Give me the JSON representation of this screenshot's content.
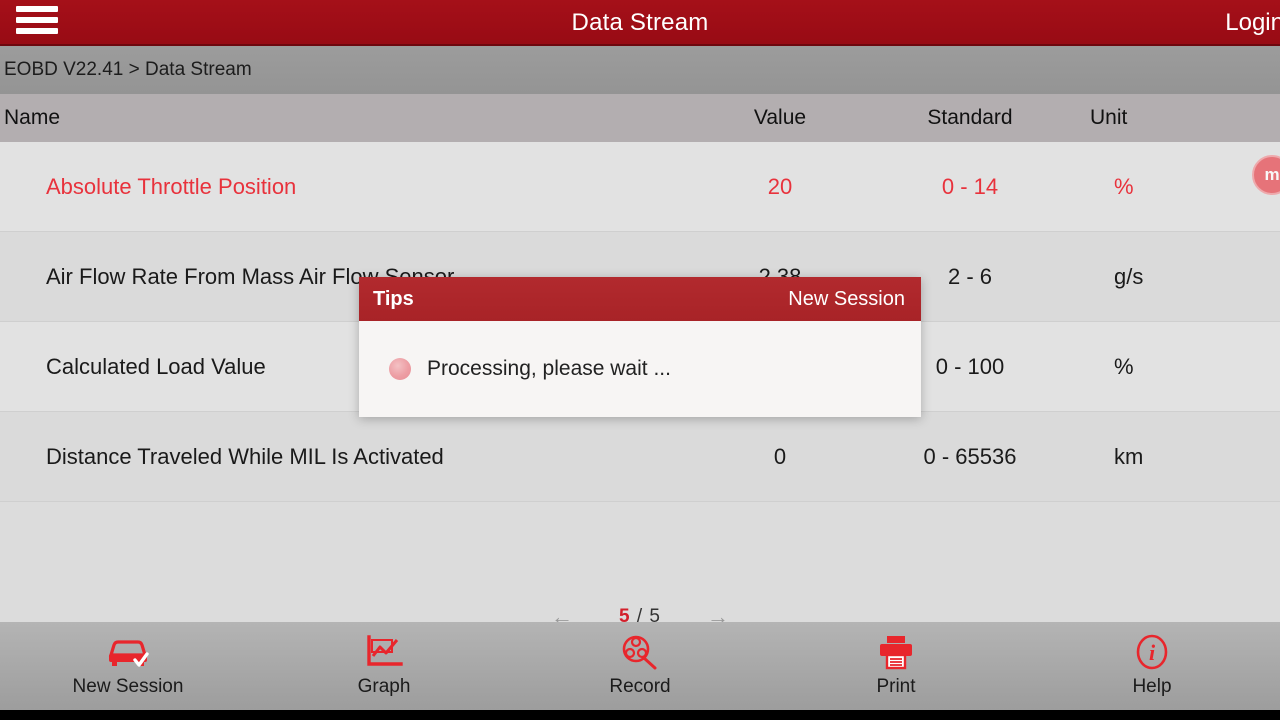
{
  "titlebar": {
    "menu_icon": "hamburger-menu-icon",
    "title": "Data Stream",
    "login_label": "Login",
    "background_color": "#9d0d17"
  },
  "breadcrumb": {
    "text": "EOBD V22.41 > Data Stream"
  },
  "table": {
    "headers": {
      "name": "Name",
      "value": "Value",
      "standard": "Standard",
      "unit": "Unit"
    },
    "rows": [
      {
        "name": "Absolute Throttle Position",
        "value": "20",
        "standard": "0 - 14",
        "unit": "%",
        "alert": true
      },
      {
        "name": "Air Flow Rate From Mass Air Flow Sensor",
        "value": "2.38",
        "standard": "2 - 6",
        "unit": "g/s",
        "alert": false
      },
      {
        "name": "Calculated Load Value",
        "value": "",
        "standard": "0 - 100",
        "unit": "%",
        "alert": false
      },
      {
        "name": "Distance Traveled While MIL Is Activated",
        "value": "0",
        "standard": "0 - 65536",
        "unit": "km",
        "alert": false
      }
    ],
    "alert_color": "#e8323c"
  },
  "edge_badge": {
    "glyph": "m"
  },
  "pager": {
    "prev_icon": "arrow-left-icon",
    "next_icon": "arrow-right-icon",
    "current": "5",
    "separator": "/",
    "total": "5"
  },
  "toolbar": {
    "items": [
      {
        "icon": "car-check-icon",
        "label": "New Session"
      },
      {
        "icon": "line-chart-icon",
        "label": "Graph"
      },
      {
        "icon": "film-search-icon",
        "label": "Record"
      },
      {
        "icon": "printer-icon",
        "label": "Print"
      },
      {
        "icon": "info-circle-icon",
        "label": "Help"
      }
    ],
    "icon_color": "#e8262c"
  },
  "dialog": {
    "title": "Tips",
    "action_label": "New Session",
    "message": "Processing, please wait ...",
    "spinner_icon": "loading-spinner-icon",
    "header_color": "#b0282c"
  }
}
